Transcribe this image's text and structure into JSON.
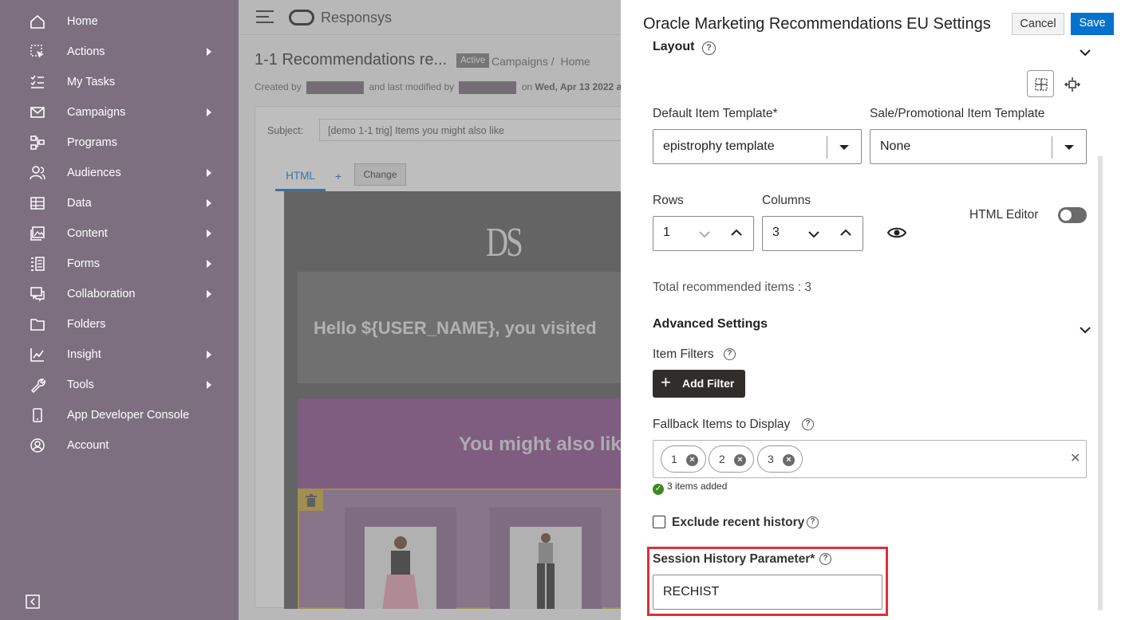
{
  "sidebar": {
    "items": [
      {
        "label": "Home",
        "icon": "home-icon",
        "arrow": false
      },
      {
        "label": "Actions",
        "icon": "cursor-select-icon",
        "arrow": true
      },
      {
        "label": "My Tasks",
        "icon": "tasks-list-icon",
        "arrow": false
      },
      {
        "label": "Campaigns",
        "icon": "envelope-icon",
        "arrow": true
      },
      {
        "label": "Programs",
        "icon": "program-flow-icon",
        "arrow": false
      },
      {
        "label": "Audiences",
        "icon": "people-icon",
        "arrow": true
      },
      {
        "label": "Data",
        "icon": "table-icon",
        "arrow": true
      },
      {
        "label": "Content",
        "icon": "image-icon",
        "arrow": true
      },
      {
        "label": "Forms",
        "icon": "form-icon",
        "arrow": true
      },
      {
        "label": "Collaboration",
        "icon": "chat-icon",
        "arrow": true
      },
      {
        "label": "Folders",
        "icon": "folder-icon",
        "arrow": false
      },
      {
        "label": "Insight",
        "icon": "chart-icon",
        "arrow": true
      },
      {
        "label": "Tools",
        "icon": "wrench-icon",
        "arrow": true
      },
      {
        "label": "App Developer Console",
        "icon": "device-icon",
        "arrow": false
      },
      {
        "label": "Account",
        "icon": "account-circle-icon",
        "arrow": false
      }
    ]
  },
  "topbar": {
    "brand": "Responsys"
  },
  "campaign": {
    "title": "1-1 Recommendations re...",
    "status": "Active",
    "crumbs": [
      "Campaigns /",
      "Home"
    ],
    "created_prefix": "Created by",
    "modified_mid": "and last modified by",
    "on_label": "on",
    "date": "Wed, Apr 13 2022 at",
    "subject_label": "Subject:",
    "subject_value": "[demo 1-1 trig] Items you might also like",
    "tab_html": "HTML",
    "tab_plus": "+",
    "change_label": "Change",
    "logo_text": "DS",
    "hello": "Hello ${USER_NAME}, you visited",
    "might": "You might also lik"
  },
  "drawer": {
    "title": "Oracle Marketing Recommendations EU Settings",
    "cancel": "Cancel",
    "save": "Save",
    "layout_heading": "Layout",
    "default_item_label": "Default Item Template*",
    "default_item_value": "epistrophy template",
    "sale_item_label": "Sale/Promotional Item Template",
    "sale_item_value": "None",
    "rows_label": "Rows",
    "rows_value": "1",
    "columns_label": "Columns",
    "columns_value": "3",
    "html_editor_label": "HTML Editor",
    "html_editor_on": false,
    "total_label": "Total recommended items : 3",
    "advanced_heading": "Advanced Settings",
    "item_filters_label": "Item Filters",
    "add_filter": "Add Filter",
    "fallback_label": "Fallback Items to Display",
    "fallback_items": [
      "1",
      "2",
      "3"
    ],
    "items_added": "3 items added",
    "exclude_label": "Exclude recent history",
    "exclude_checked": false,
    "session_label": "Session History Parameter*",
    "session_value": "RECHIST"
  },
  "colors": {
    "sidebar_bg": "#7d6f80",
    "primary": "#0572ce",
    "highlight": "#d9323a",
    "dark_button": "#312d2a"
  }
}
